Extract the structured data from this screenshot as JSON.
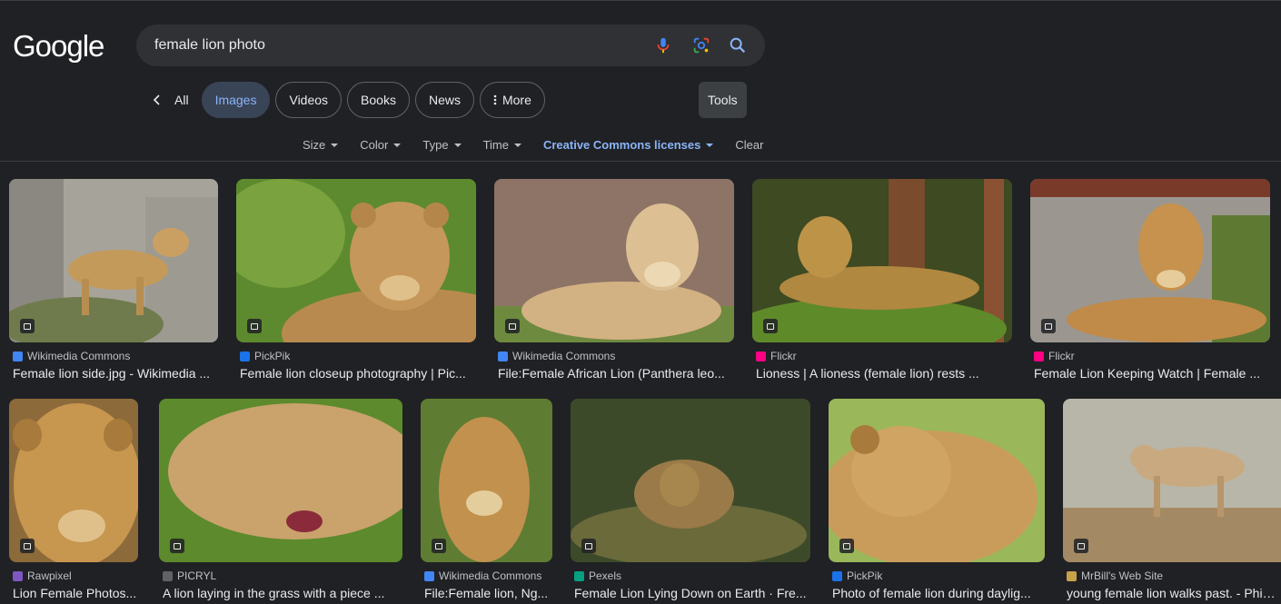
{
  "header": {
    "logo": "Google",
    "search": {
      "value": "female lion photo",
      "placeholder": ""
    },
    "icons": [
      "microphone-icon",
      "lens-icon",
      "search-icon"
    ]
  },
  "nav": {
    "back_label": "All",
    "tabs": [
      {
        "label": "Images",
        "active": true
      },
      {
        "label": "Videos"
      },
      {
        "label": "Books"
      },
      {
        "label": "News"
      },
      {
        "label": "More"
      }
    ],
    "tools_label": "Tools"
  },
  "filters": {
    "items": [
      "Size",
      "Color",
      "Type",
      "Time",
      "Creative Commons licenses"
    ],
    "clear_label": "Clear"
  },
  "results": [
    {
      "source": "Wikimedia Commons",
      "title": "Female lion side.jpg - Wikimedia ...",
      "favicon_color": "#4285f4"
    },
    {
      "source": "PickPik",
      "title": "Female lion closeup photography | Pic...",
      "favicon_color": "#1a73e8"
    },
    {
      "source": "Wikimedia Commons",
      "title": "File:Female African Lion (Panthera leo...",
      "favicon_color": "#4285f4"
    },
    {
      "source": "Flickr",
      "title": "Lioness | A lioness (female lion) rests ...",
      "favicon_color": "#ff0084"
    },
    {
      "source": "Flickr",
      "title": "Female Lion Keeping Watch | Female ...",
      "favicon_color": "#ff0084"
    },
    {
      "source": "Rawpixel",
      "title": "Lion Female Photos...",
      "favicon_color": "#7e57c2"
    },
    {
      "source": "PICRYL",
      "title": "A lion laying in the grass with a piece ...",
      "favicon_color": "#5f6368"
    },
    {
      "source": "Wikimedia Commons",
      "title": "File:Female lion, Ng...",
      "favicon_color": "#4285f4"
    },
    {
      "source": "Pexels",
      "title": "Female Lion Lying Down on Earth · Fre...",
      "favicon_color": "#05a081"
    },
    {
      "source": "PickPik",
      "title": "Photo of female lion during daylig...",
      "favicon_color": "#1a73e8"
    },
    {
      "source": "MrBill's Web Site",
      "title": "young female lion walks past. - Phind...",
      "favicon_color": "#c8a24a"
    }
  ]
}
